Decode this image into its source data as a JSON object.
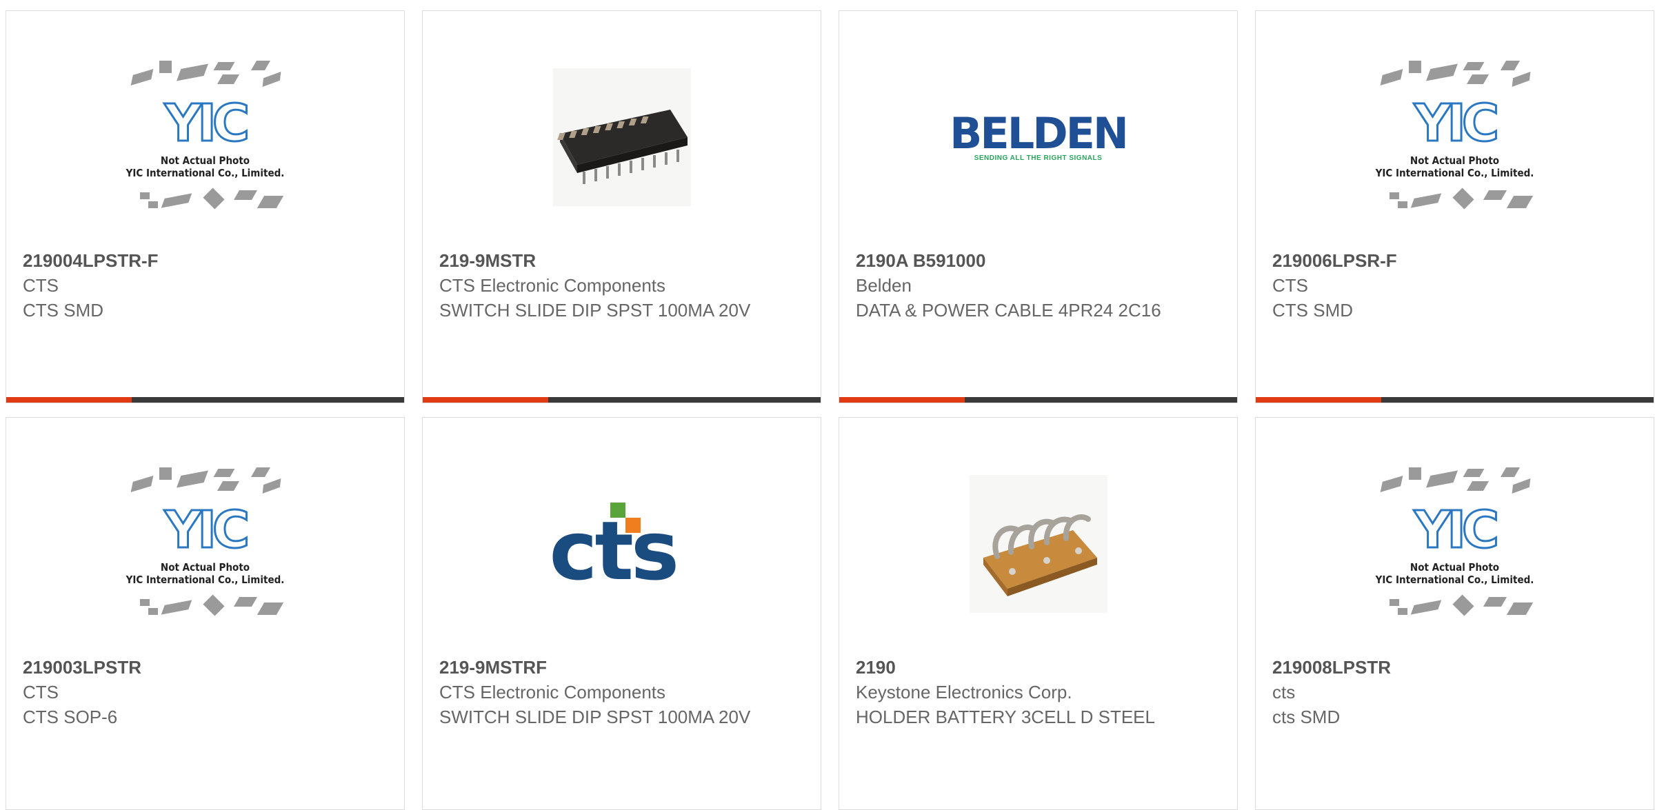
{
  "products": [
    {
      "part_number": "219004LPSTR-F",
      "manufacturer": "CTS",
      "description": "CTS SMD",
      "image": "yic-placeholder",
      "image_caption": [
        "Not Actual Photo",
        "YIC International Co., Limited."
      ]
    },
    {
      "part_number": "219-9MSTR",
      "manufacturer": "CTS Electronic Components",
      "description": "SWITCH SLIDE DIP SPST 100MA 20V",
      "image": "dip-switch-photo"
    },
    {
      "part_number": "2190A B591000",
      "manufacturer": "Belden",
      "description": "DATA & POWER CABLE 4PR24 2C16",
      "image": "belden-logo",
      "logo_text": "BELDEN",
      "logo_tagline": "SENDING ALL THE RIGHT SIGNALS"
    },
    {
      "part_number": "219006LPSR-F",
      "manufacturer": "CTS",
      "description": "CTS SMD",
      "image": "yic-placeholder",
      "image_caption": [
        "Not Actual Photo",
        "YIC International Co., Limited."
      ]
    },
    {
      "part_number": "219003LPSTR",
      "manufacturer": "CTS",
      "description": "CTS SOP-6",
      "image": "yic-placeholder",
      "image_caption": [
        "Not Actual Photo",
        "YIC International Co., Limited."
      ]
    },
    {
      "part_number": "219-9MSTRF",
      "manufacturer": "CTS Electronic Components",
      "description": "SWITCH SLIDE DIP SPST 100MA 20V",
      "image": "cts-logo",
      "logo_text": "cts"
    },
    {
      "part_number": "2190",
      "manufacturer": "Keystone Electronics Corp.",
      "description": "HOLDER BATTERY 3CELL D STEEL",
      "image": "battery-holder-photo"
    },
    {
      "part_number": "219008LPSTR",
      "manufacturer": "cts",
      "description": "cts SMD",
      "image": "yic-placeholder",
      "image_caption": [
        "Not Actual Photo",
        "YIC International Co., Limited."
      ]
    }
  ],
  "yic_logo_text": "YIC",
  "colors": {
    "accent": "#e03b12",
    "bar": "#3a3a3a",
    "border": "#dcdcdc",
    "text": "#666666"
  }
}
